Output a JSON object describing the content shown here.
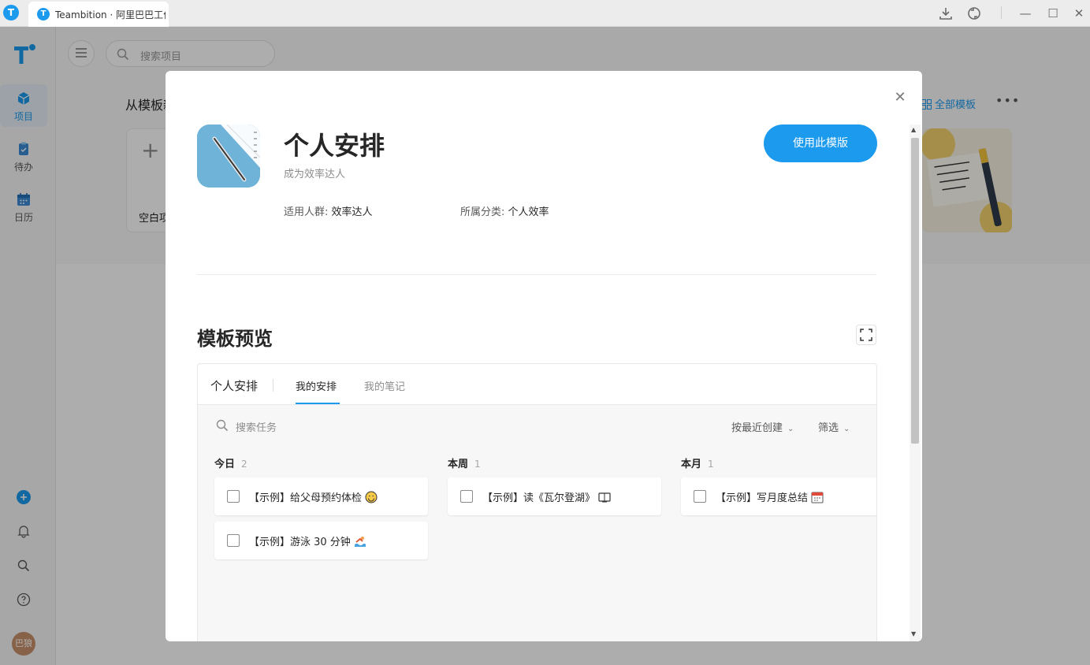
{
  "titlebar": {
    "app_icon_glyph": "T",
    "tab_title": "Teambition · 阿里巴巴工作台",
    "download_icon": "download-icon",
    "sync_icon": "sync-icon",
    "minimize_glyph": "—",
    "maximize_glyph": "☐",
    "close_glyph": "✕"
  },
  "sidebar": {
    "items": [
      {
        "label": "项目",
        "icon": "project-cube-icon",
        "active": true
      },
      {
        "label": "待办",
        "icon": "todo-clipboard-icon",
        "active": false
      },
      {
        "label": "日历",
        "icon": "calendar-icon",
        "active": false
      }
    ],
    "add_glyph": "+",
    "avatar_text": "巴狼"
  },
  "main": {
    "search_placeholder": "搜索项目",
    "section_title": "从模板新建",
    "all_templates_label": "全部模板",
    "more_glyph": "•••",
    "blank_card_plus": "+",
    "blank_card_label": "空白项目"
  },
  "modal": {
    "close_glyph": "✕",
    "template_name": "个人安排",
    "template_subtitle": "成为效率达人",
    "audience_label": "适用人群: ",
    "audience_value": "效率达人",
    "category_label": "所属分类: ",
    "category_value": "个人效率",
    "use_button_label": "使用此模版",
    "preview_title": "模板预览",
    "scroll_up_glyph": "▲",
    "scroll_down_glyph": "▼"
  },
  "preview": {
    "project_name": "个人安排",
    "tabs": [
      {
        "label": "我的安排",
        "active": true
      },
      {
        "label": "我的笔记",
        "active": false
      }
    ],
    "search_placeholder": "搜索任务",
    "sort_label": "按最近创建",
    "filter_label": "筛选",
    "chevron_glyph": "⌄",
    "columns": [
      {
        "title": "今日",
        "count": "2",
        "tasks": [
          {
            "text": "【示例】给父母预约体检",
            "emoji": "smile-emoji-icon"
          },
          {
            "text": "【示例】游泳 30 分钟",
            "emoji": "swimmer-emoji-icon"
          }
        ]
      },
      {
        "title": "本周",
        "count": "1",
        "tasks": [
          {
            "text": "【示例】读《瓦尔登湖》",
            "emoji": "book-emoji-icon"
          }
        ]
      },
      {
        "title": "本月",
        "count": "1",
        "tasks": [
          {
            "text": "【示例】写月度总结",
            "emoji": "calendar-emoji-icon"
          }
        ]
      }
    ]
  },
  "colors": {
    "accent": "#1b9aee",
    "overlay": "rgba(0,0,0,0.32)",
    "avatar": "#c9916b"
  }
}
